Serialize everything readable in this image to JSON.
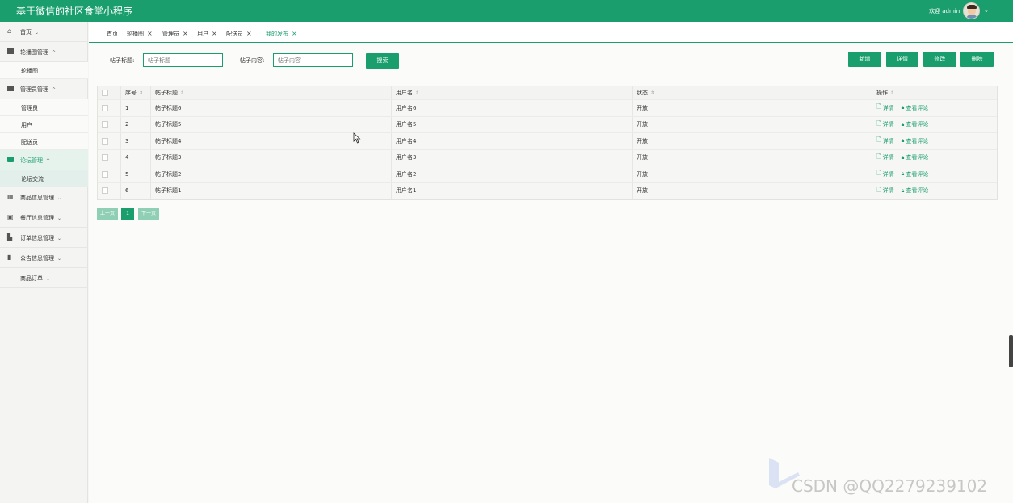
{
  "app": {
    "title": "基于微信的社区食堂小程序",
    "welcome": "欢迎 admin",
    "user_chevron": "⌄"
  },
  "sidebar": {
    "items": [
      {
        "label": "首页",
        "icon": "home-icon",
        "arrow": "⌄"
      },
      {
        "label": "轮播图管理",
        "icon": "carousel-icon",
        "arrow": "^"
      },
      {
        "label": "轮播图",
        "sub": true
      },
      {
        "label": "管理员管理",
        "icon": "admin-icon",
        "arrow": "^"
      },
      {
        "label": "管理员",
        "sub": true
      },
      {
        "label": "用户",
        "sub": true
      },
      {
        "label": "配送员",
        "sub": true
      },
      {
        "label": "论坛管理",
        "icon": "forum-icon",
        "arrow": "^",
        "active": true
      },
      {
        "label": "论坛交流",
        "sub": true,
        "active": true
      },
      {
        "label": "商品信息管理",
        "icon": "grid-icon",
        "arrow": "⌄"
      },
      {
        "label": "餐厅信息管理",
        "icon": "restaurant-icon",
        "arrow": "⌄"
      },
      {
        "label": "订单信息管理",
        "icon": "order-icon",
        "arrow": "⌄"
      },
      {
        "label": "公告信息管理",
        "icon": "notice-icon",
        "arrow": "⌄"
      },
      {
        "label": "商品订单",
        "arrow": "⌄"
      }
    ]
  },
  "tabs": [
    {
      "label": "首页",
      "closable": false
    },
    {
      "label": "轮播图",
      "closable": true
    },
    {
      "label": "管理员",
      "closable": true
    },
    {
      "label": "用户",
      "closable": true
    },
    {
      "label": "配送员",
      "closable": true
    },
    {
      "label": "我的发布",
      "closable": true,
      "active": true
    }
  ],
  "tab_close": "×",
  "search": {
    "title_label": "帖子标题:",
    "title_placeholder": "帖子标题",
    "content_label": "帖子内容:",
    "content_placeholder": "帖子内容",
    "search_button": "搜索"
  },
  "toolbar": {
    "add": "新增",
    "detail": "详情",
    "edit": "修改",
    "delete": "删除"
  },
  "table": {
    "headers": [
      "序号",
      "帖子标题",
      "用户名",
      "状态",
      "操作"
    ],
    "sort_icon": "⇕",
    "rows": [
      {
        "index": "1",
        "title": "帖子标题6",
        "user": "用户名6",
        "status": "开放"
      },
      {
        "index": "2",
        "title": "帖子标题5",
        "user": "用户名5",
        "status": "开放"
      },
      {
        "index": "3",
        "title": "帖子标题4",
        "user": "用户名4",
        "status": "开放"
      },
      {
        "index": "4",
        "title": "帖子标题3",
        "user": "用户名3",
        "status": "开放"
      },
      {
        "index": "5",
        "title": "帖子标题2",
        "user": "用户名2",
        "status": "开放"
      },
      {
        "index": "6",
        "title": "帖子标题1",
        "user": "用户名1",
        "status": "开放"
      }
    ],
    "row_actions": {
      "detail": "详情",
      "comments": "查看评论"
    }
  },
  "pager": {
    "prev": "上一页",
    "current": "1",
    "next": "下一页"
  },
  "watermark": "CSDN @QQ2279239102",
  "colors": {
    "primary": "#1a9e6e",
    "sidebar_bg": "#f4f4f2",
    "pager_disabled": "#8fcfb5"
  }
}
